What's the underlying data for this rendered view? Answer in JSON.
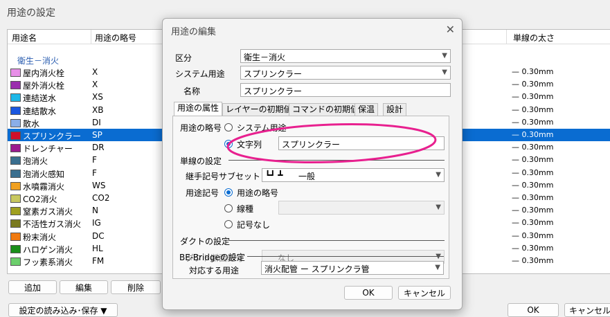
{
  "bg": {
    "title": "用途の設定",
    "header": {
      "name": "用途名",
      "abbr": "用途の略号",
      "width": "単線の太さ"
    },
    "group": "衛生－消火",
    "rows": [
      {
        "name": "屋内消火栓",
        "abbr": "X",
        "width": "— 0.30mm",
        "color": "#e88fe8"
      },
      {
        "name": "屋外消火栓",
        "abbr": "X",
        "width": "— 0.30mm",
        "color": "#9b2fae"
      },
      {
        "name": "連結送水",
        "abbr": "XS",
        "width": "— 0.30mm",
        "color": "#1fb8e8"
      },
      {
        "name": "連結散水",
        "abbr": "XB",
        "width": "— 0.30mm",
        "color": "#1a57e0"
      },
      {
        "name": "散水",
        "abbr": "DI",
        "width": "— 0.30mm",
        "color": "#8aaee8"
      },
      {
        "name": "スプリンクラー",
        "abbr": "SP",
        "width": "— 0.30mm",
        "color": "#d0102a",
        "selected": true
      },
      {
        "name": "ドレンチャー",
        "abbr": "DR",
        "width": "— 0.30mm",
        "color": "#9b1a8f"
      },
      {
        "name": "泡消火",
        "abbr": "F",
        "width": "— 0.30mm",
        "color": "#3a6f8f"
      },
      {
        "name": "泡消火感知",
        "abbr": "F",
        "width": "— 0.30mm",
        "color": "#3a6f8f"
      },
      {
        "name": "水噴霧消火",
        "abbr": "WS",
        "width": "— 0.30mm",
        "color": "#f0a020"
      },
      {
        "name": "CO2消火",
        "abbr": "CO2",
        "width": "— 0.30mm",
        "color": "#c8c860"
      },
      {
        "name": "窒素ガス消火",
        "abbr": "N",
        "width": "— 0.30mm",
        "color": "#a0a020"
      },
      {
        "name": "不活性ガス消火",
        "abbr": "IG",
        "width": "— 0.30mm",
        "color": "#7a7a20"
      },
      {
        "name": "粉末消火",
        "abbr": "DC",
        "width": "— 0.30mm",
        "color": "#f07a10"
      },
      {
        "name": "ハロゲン消火",
        "abbr": "HL",
        "width": "— 0.30mm",
        "color": "#1a8f1a"
      },
      {
        "name": "フッ素系消火",
        "abbr": "FM",
        "width": "— 0.30mm",
        "color": "#6ccf6c"
      }
    ],
    "buttons": {
      "add": "追加",
      "edit": "編集",
      "delete": "削除",
      "load_save": "設定の読み込み･保存 ▼",
      "ok": "OK",
      "cancel": "キャンセル"
    }
  },
  "dialog": {
    "title": "用途の編集",
    "fields": {
      "category_label": "区分",
      "category_value": "衛生－消火",
      "system_label": "システム用途",
      "system_value": "スプリンクラー",
      "name_label": "名称",
      "name_value": "スプリンクラー"
    },
    "tabs": [
      "用途の属性",
      "レイヤーの初期値",
      "コマンドの初期値",
      "保温",
      "設計"
    ],
    "abbr": {
      "label": "用途の略号",
      "opt_system": "システム用途",
      "opt_string": "文字列",
      "string_value": "スプリンクラー"
    },
    "single_line": {
      "section": "単線の設定",
      "fitting_label": "継手記号サブセット",
      "fitting_value": "一般",
      "symbol_label": "用途記号",
      "opt_abbr": "用途の略号",
      "opt_linetype": "線種",
      "opt_none": "記号なし"
    },
    "duct": {
      "section": "ダクトの設定",
      "label": "ダクト断面記号",
      "value": "なし"
    },
    "bebridge": {
      "section": "BE-Bridgeの設定",
      "label": "対応する用途",
      "value": "消火配管 ー スプリンクラ管"
    },
    "buttons": {
      "ok": "OK",
      "cancel": "キャンセル"
    }
  },
  "annotation_color": "#e8208f"
}
